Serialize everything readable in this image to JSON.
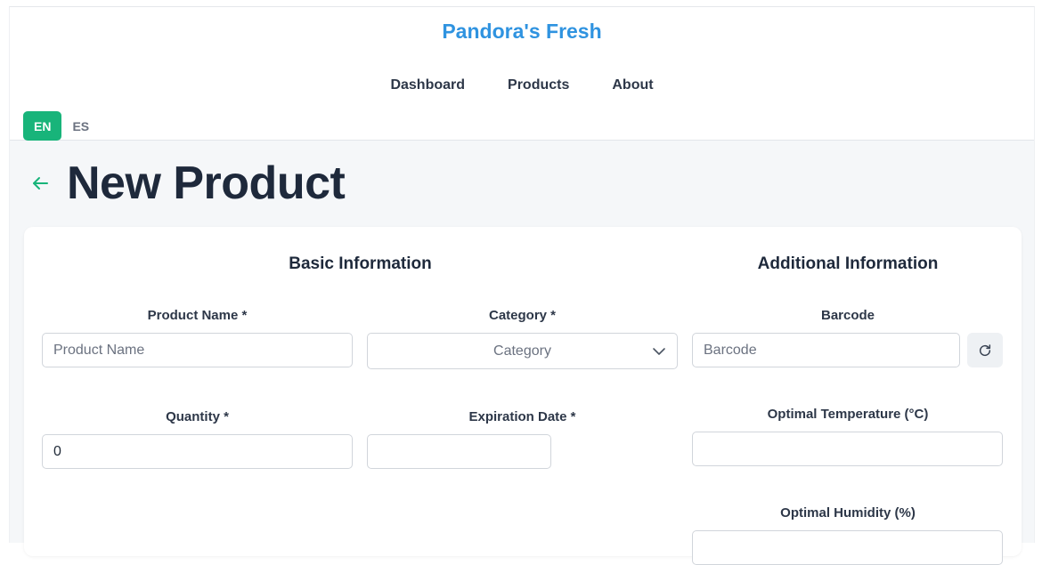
{
  "header": {
    "brand": "Pandora's Fresh",
    "nav": [
      "Dashboard",
      "Products",
      "About"
    ],
    "languages": {
      "active": "EN",
      "inactive": "ES"
    }
  },
  "page": {
    "title": "New Product"
  },
  "form": {
    "basic_section": "Basic Information",
    "additional_section": "Additional Information",
    "product_name": {
      "label": "Product Name *",
      "placeholder": "Product Name",
      "value": ""
    },
    "category": {
      "label": "Category *",
      "placeholder": "Category"
    },
    "quantity": {
      "label": "Quantity *",
      "value": "0"
    },
    "expiration_date": {
      "label": "Expiration Date *",
      "value": ""
    },
    "barcode": {
      "label": "Barcode",
      "placeholder": "Barcode",
      "value": ""
    },
    "optimal_temperature": {
      "label": "Optimal Temperature (°C)",
      "value": ""
    },
    "optimal_humidity": {
      "label": "Optimal Humidity (%)",
      "value": ""
    }
  },
  "icons": {
    "back": "arrow-left-icon",
    "category_dropdown": "chevron-down-icon",
    "barcode_generate": "refresh-icon"
  },
  "colors": {
    "brand": "#2f93e0",
    "accent": "#18b47a",
    "title": "#1e293b"
  }
}
